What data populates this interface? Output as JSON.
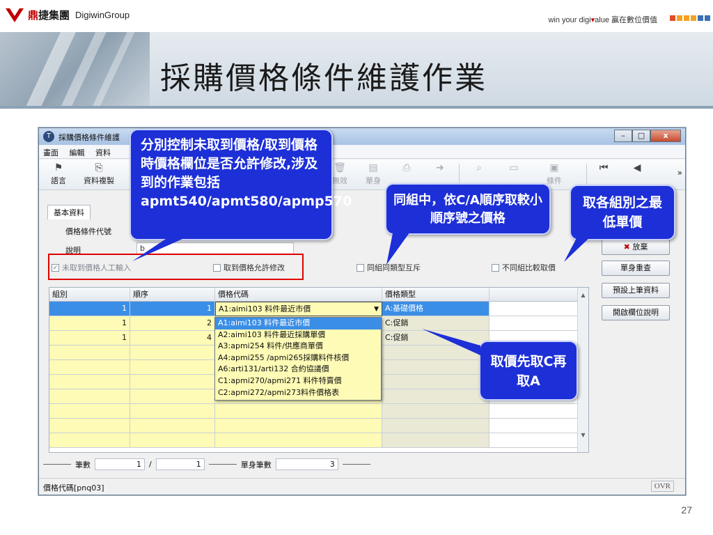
{
  "header": {
    "company_cn_red": "鼎",
    "company_cn_rest": "捷集團",
    "company_en": "DigiwinGroup",
    "tagline_pre": "win your digi",
    "tagline_red": "▾",
    "tagline_post": "alue 贏在數位價值",
    "slide_title": "採購價格條件維護作業",
    "square_colors": [
      "#e24b2a",
      "#f3a21d",
      "#f3a21d",
      "#f3a21d",
      "#3b6fb6",
      "#3b6fb6"
    ]
  },
  "window": {
    "title": "採購價格條件維護",
    "controls": [
      "–",
      "□",
      "x"
    ],
    "menu": [
      "畫面",
      "編輯",
      "資料"
    ],
    "toolbar": [
      {
        "icon": "flag-icon",
        "glyph": "⚑",
        "label": "語言"
      },
      {
        "icon": "copy-icon",
        "glyph": "⎘",
        "label": "資料複製"
      },
      {
        "icon": "trash-icon",
        "glyph": "🗑",
        "label": "無效"
      },
      {
        "icon": "doc-icon",
        "glyph": "▤",
        "label": "單身"
      },
      {
        "icon": "printer-icon",
        "glyph": "⎙",
        "label": ""
      },
      {
        "icon": "arrow-icon",
        "glyph": "➜",
        "label": ""
      },
      {
        "icon": "binoculars-icon",
        "glyph": "⌕",
        "label": ""
      },
      {
        "icon": "page-icon",
        "glyph": "▭",
        "label": ""
      },
      {
        "icon": "condition-icon",
        "glyph": "▣",
        "label": "條件"
      },
      {
        "icon": "first-icon",
        "glyph": "⏮",
        "label": ""
      },
      {
        "icon": "prev-icon",
        "glyph": "◀",
        "label": ""
      }
    ],
    "more_glyph": "»",
    "tab_label": "基本資料",
    "fields": {
      "code_label": "價格條件代號",
      "desc_label": "說明",
      "desc_value": "b"
    },
    "checkboxes": [
      {
        "label": "未取到價格人工輸入",
        "checked": true
      },
      {
        "label": "取到價格允許修改",
        "checked": false
      },
      {
        "label": "同組同類型互斥",
        "checked": false
      },
      {
        "label": "不同組比較取價",
        "checked": false
      }
    ],
    "grid": {
      "columns": [
        "組別",
        "順序",
        "價格代碼",
        "價格類型"
      ],
      "rows": [
        {
          "group": "1",
          "seq": "1",
          "code": "A1:aimi103 料件最近市價",
          "type": "A:基礎價格"
        },
        {
          "group": "1",
          "seq": "2",
          "code": "",
          "type": "C:促銷"
        },
        {
          "group": "1",
          "seq": "4",
          "code": "",
          "type": "C:促銷"
        }
      ],
      "scroll_up": "▲",
      "scroll_down": "▼",
      "combo_arrow": "▼"
    },
    "dropdown_options": [
      "A1:aimi103 料件最近市價",
      "A2:aimi103 料件最近採購單價",
      "A3:apmi254 料件/供應商單價",
      "A4:apmi255 /apmi265採購料件核價",
      "A6:arti131/arti132 合約協議價",
      "C1:apmi270/apmi271 料件特賣價",
      "C2:apmi272/apmi273料件價格表"
    ],
    "side_buttons": {
      "discard": "放棄",
      "discard_icon": "✖",
      "requery": "單身重查",
      "preset": "預設上筆資料",
      "help": "開啟欄位說明"
    },
    "footer": {
      "count_label": "筆數",
      "current": "1",
      "slash": "/",
      "total": "1",
      "body_count_label": "單身筆數",
      "body_count": "3"
    },
    "status_text": "價格代碼[pnq03]",
    "ovr": "OVR"
  },
  "callouts": {
    "control": "分別控制未取到價格/取到價格時價格欄位是否允許修改,涉及到的作業包括apmt540/apmt580/apmp570",
    "group_order": "同組中，依C/A順序取較小順序號之價格",
    "min_price": "取各組別之最低單價",
    "take_first": "取價先取C再取A"
  },
  "page_number": "27"
}
